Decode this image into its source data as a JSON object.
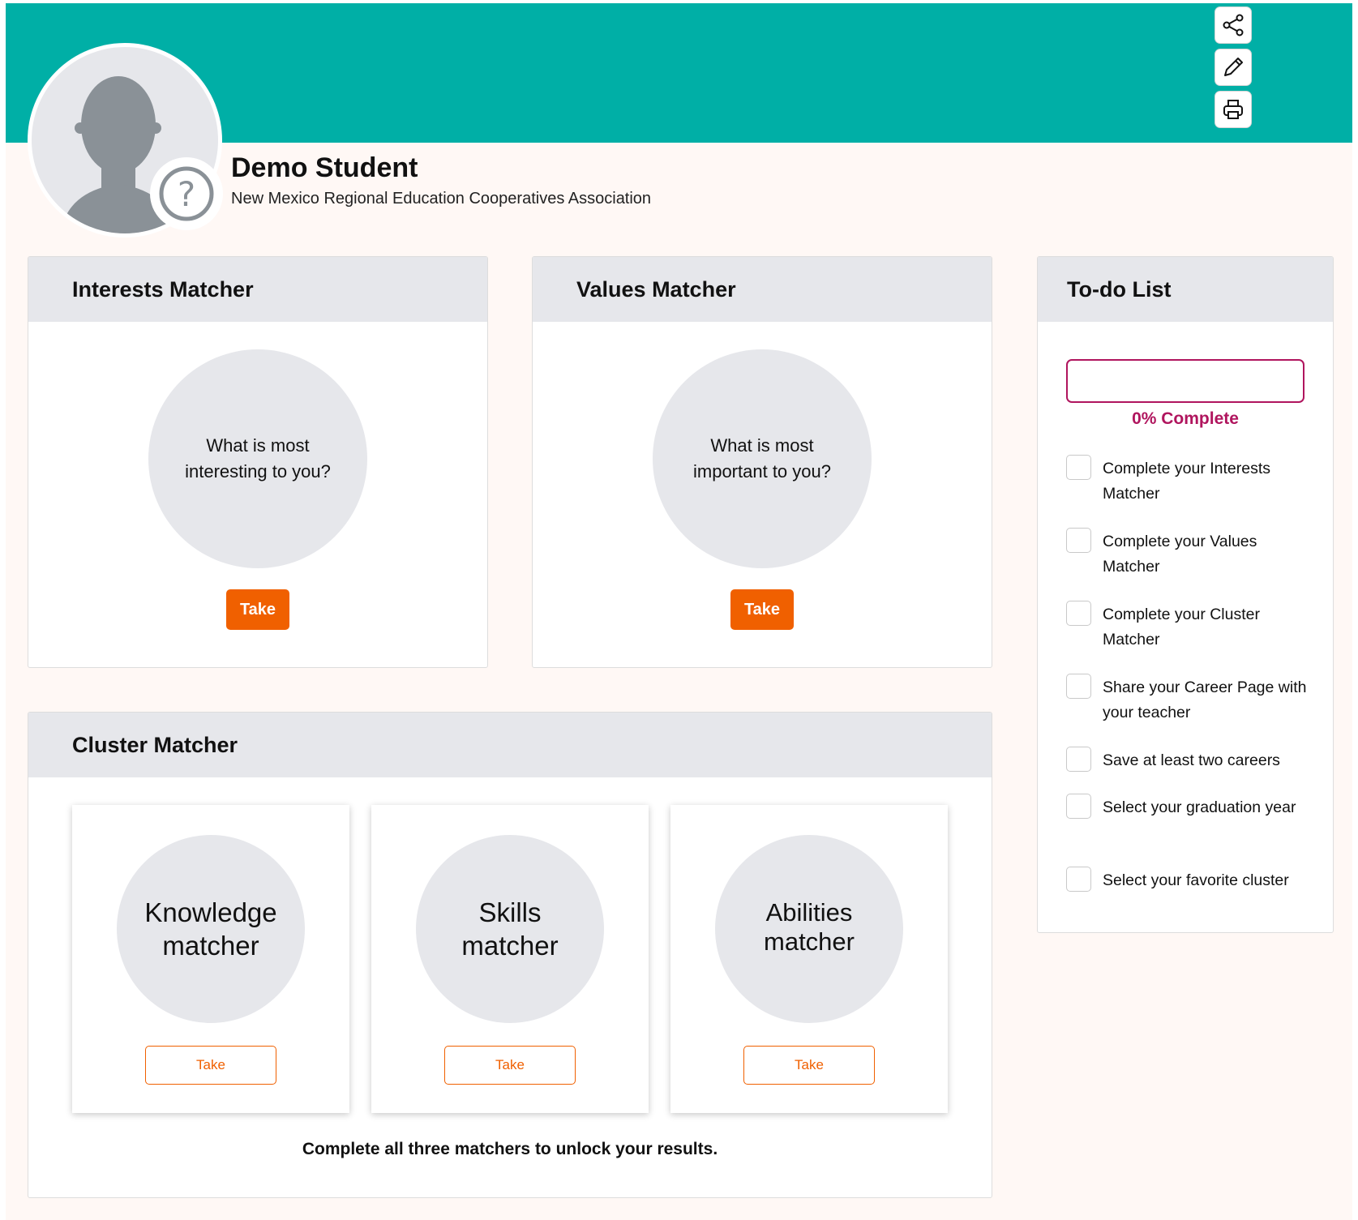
{
  "profile": {
    "name": "Demo Student",
    "organization": "New Mexico Regional Education Cooperatives Association",
    "avatar_icon": "person-silhouette-icon",
    "badge_icon": "question-circle-icon"
  },
  "toolbar": [
    {
      "icon": "share-icon"
    },
    {
      "icon": "pencil-icon"
    },
    {
      "icon": "printer-icon"
    }
  ],
  "interests": {
    "title": "Interests Matcher",
    "question_line1": "What is most",
    "question_line2": "interesting to you?",
    "take_label": "Take"
  },
  "values": {
    "title": "Values Matcher",
    "question_line1": "What is most",
    "question_line2": "important to you?",
    "take_label": "Take"
  },
  "cluster": {
    "title": "Cluster Matcher",
    "matchers": [
      {
        "line1": "Knowledge",
        "line2": "matcher",
        "take_label": "Take"
      },
      {
        "line1": "Skills",
        "line2": "matcher",
        "take_label": "Take"
      },
      {
        "line1": "Abilities",
        "line2": "matcher",
        "take_label": "Take"
      }
    ],
    "footnote": "Complete all three matchers to unlock your results."
  },
  "todo": {
    "title": "To-do List",
    "progress_percent": 0,
    "progress_label": "0% Complete",
    "items": [
      {
        "label": "Complete your Interests Matcher",
        "checked": false
      },
      {
        "label": "Complete your Values Matcher",
        "checked": false
      },
      {
        "label": "Complete your Cluster Matcher",
        "checked": false
      },
      {
        "label": "Share your Career Page with your teacher",
        "checked": false
      },
      {
        "label": "Save at least two careers",
        "checked": false
      },
      {
        "label": "Select your graduation year",
        "checked": false
      },
      {
        "label": "Select your favorite cluster",
        "checked": false
      }
    ]
  },
  "colors": {
    "banner": "#00afa6",
    "accent_orange": "#f06000",
    "progress_magenta": "#b0155e",
    "circle_gray": "#e6e7eb"
  }
}
